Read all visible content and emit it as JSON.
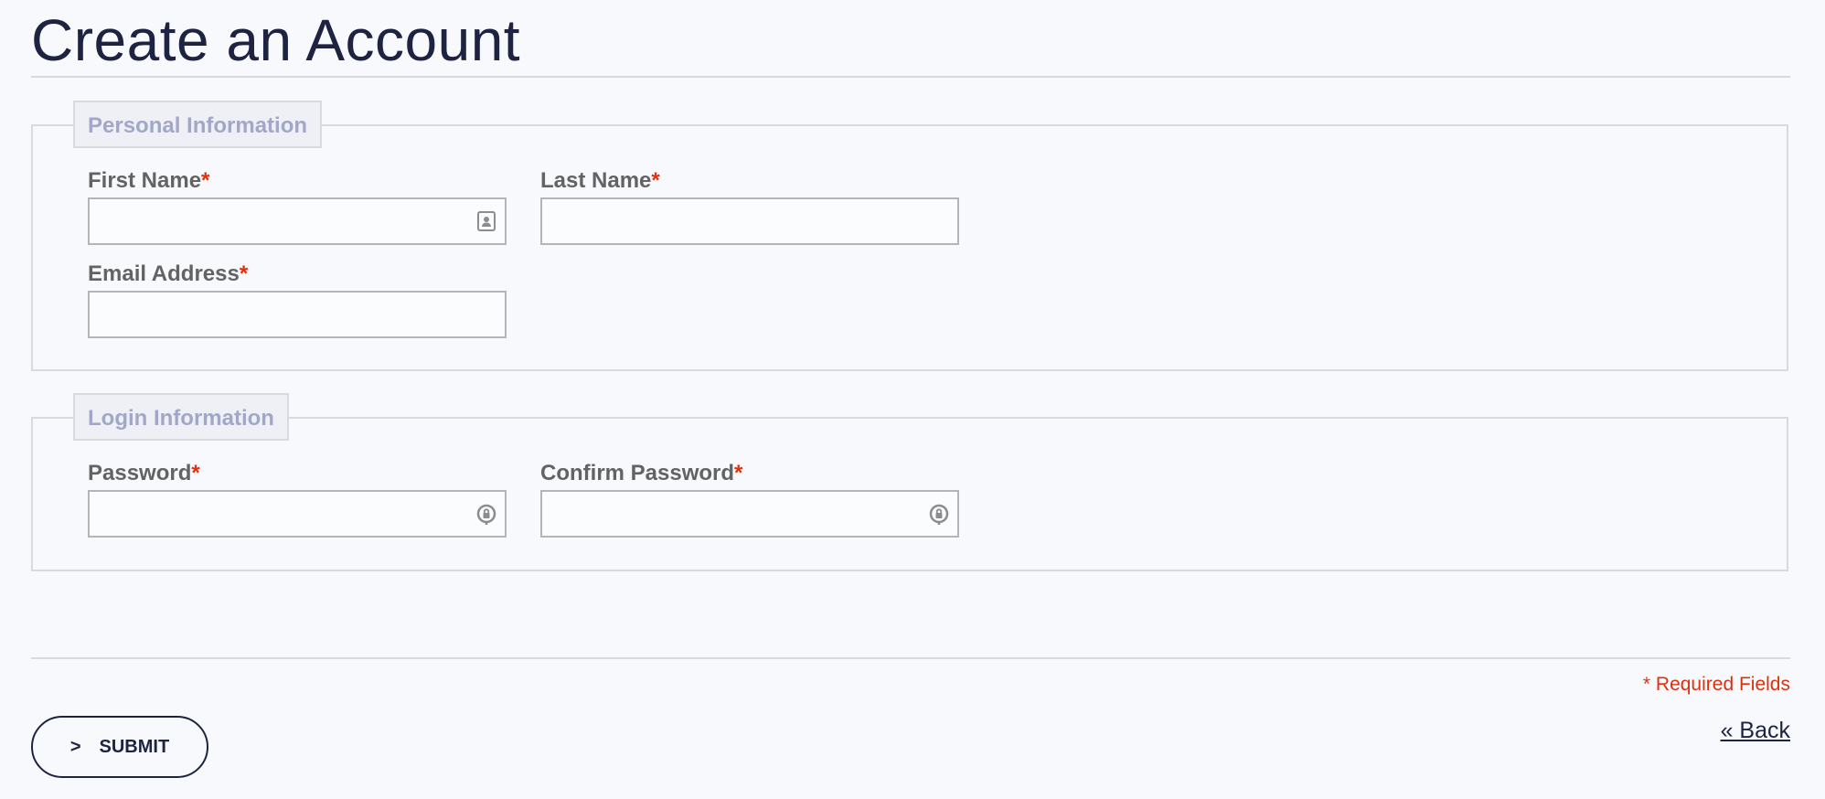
{
  "page": {
    "title": "Create an Account"
  },
  "personal": {
    "legend": "Personal Information",
    "first_name": {
      "label": "First Name",
      "required_mark": "*",
      "value": ""
    },
    "last_name": {
      "label": "Last Name",
      "required_mark": "*",
      "value": ""
    },
    "email": {
      "label": "Email Address",
      "required_mark": "*",
      "value": ""
    }
  },
  "login": {
    "legend": "Login Information",
    "password": {
      "label": "Password",
      "required_mark": "*",
      "value": ""
    },
    "confirm_password": {
      "label": "Confirm Password",
      "required_mark": "*",
      "value": ""
    }
  },
  "footer": {
    "required_note": "* Required Fields",
    "submit_arrow": ">",
    "submit_label": "SUBMIT",
    "back_label": "« Back"
  },
  "icons": {
    "contact_card": "contact-card-icon",
    "password_key": "password-key-icon"
  },
  "colors": {
    "title": "#1d2340",
    "required": "#e0300d",
    "legend_text": "#a3a7c7",
    "border": "#d6dae2"
  }
}
